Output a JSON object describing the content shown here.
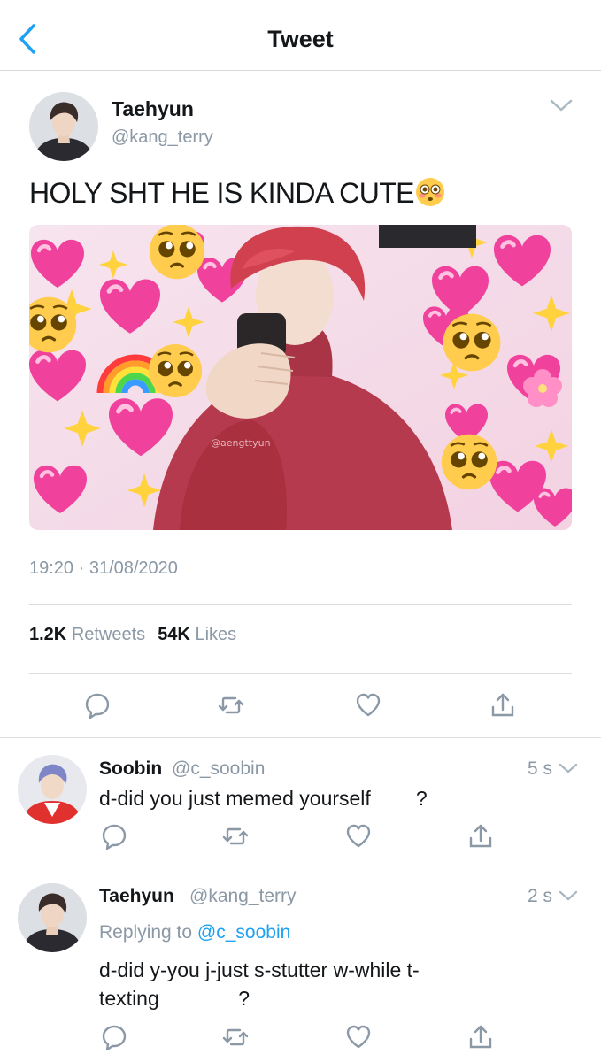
{
  "header": {
    "title": "Tweet",
    "back_icon": "chevron-left-icon",
    "accent": "#1da1f2"
  },
  "main_tweet": {
    "author_name": "Taehyun",
    "author_handle": "@kang_terry",
    "text": "HOLY SHT HE IS KINDA CUTE",
    "text_emoji": "flushed-face-emoji",
    "media_description": "red-haired boy in red hoodie covering mouth, surrounded by heart, sparkle, rainbow and pleading-face emojis",
    "media_watermark": "@aengttyun",
    "timestamp": "19:20 · 31/08/2020",
    "retweets_count": "1.2K",
    "retweets_label": "Retweets",
    "likes_count": "54K",
    "likes_label": "Likes",
    "actions": [
      "reply-icon",
      "retweet-icon",
      "like-icon",
      "share-icon"
    ]
  },
  "replies": [
    {
      "author_name": "Soobin",
      "author_handle": "@c_soobin",
      "age": "5 s",
      "text": "d-did you just memed yourself        ?"
    },
    {
      "author_name": "Taehyun",
      "author_handle": "@kang_terry",
      "age": "2 s",
      "replying_prefix": "Replying to ",
      "replying_to": "@c_soobin",
      "text_line1": "d-did y-you j-just s-stutter w-while t-",
      "text_line2": "texting              ?"
    }
  ]
}
